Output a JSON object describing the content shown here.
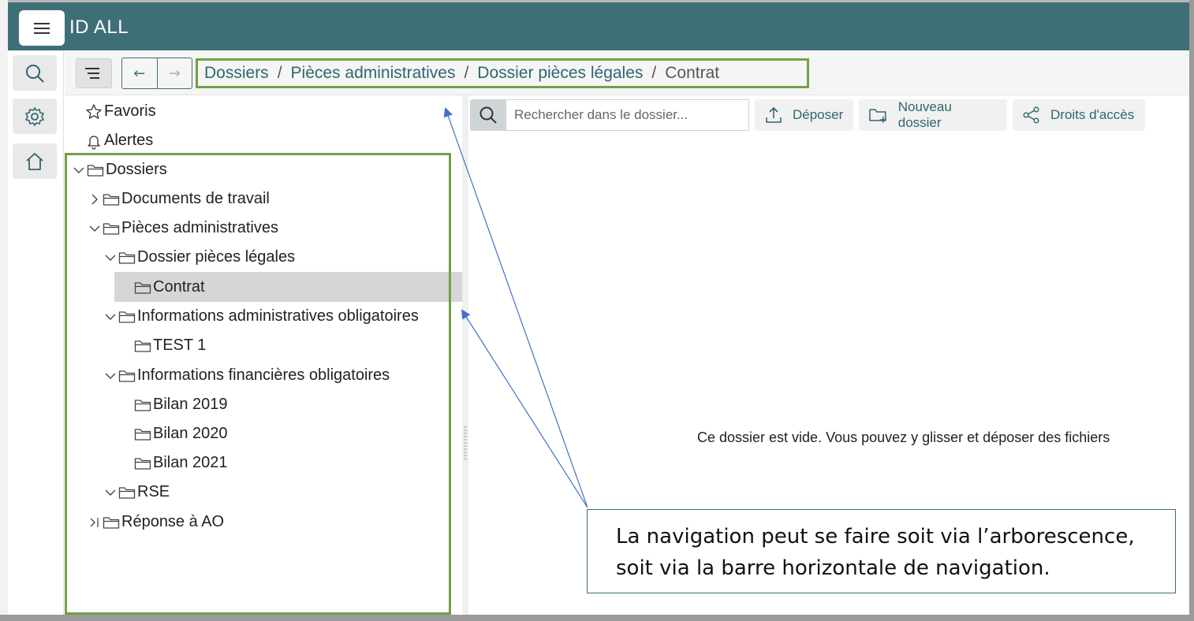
{
  "app": {
    "title": "ID ALL",
    "menu_icon": "hamburger-icon"
  },
  "rail": {
    "items": [
      {
        "icon": "search-icon"
      },
      {
        "icon": "gear-icon"
      },
      {
        "icon": "home-icon"
      }
    ]
  },
  "breadcrumb": {
    "items": [
      "Dossiers",
      "Pièces administratives",
      "Dossier pièces légales",
      "Contrat"
    ],
    "separator": "/",
    "back_label": "←",
    "forward_label": "→"
  },
  "tree": {
    "favorites": "Favoris",
    "alerts": "Alertes",
    "root": "Dossiers",
    "nodes": [
      "Documents de travail",
      "Pièces administratives",
      "Dossier pièces légales",
      "Contrat",
      "Informations administratives obligatoires",
      "TEST 1",
      "Informations financières obligatoires",
      "Bilan 2019",
      "Bilan 2020",
      "Bilan 2021",
      "RSE",
      "Réponse à AO"
    ]
  },
  "toolbar": {
    "search_placeholder": "Rechercher dans le dossier...",
    "upload_label": "Déposer",
    "new_folder_label": "Nouveau dossier",
    "access_label": "Droits d'accès"
  },
  "main": {
    "empty_message": "Ce dossier est vide. Vous pouvez y glisser et déposer des fichiers"
  },
  "callout": {
    "line1": "La navigation peut se faire soit via l’arborescence,",
    "line2": "soit via la barre horizontale de navigation."
  },
  "colors": {
    "brand": "#3f6f76",
    "highlight": "#72a045",
    "link": "#2f6670",
    "arrow": "#4472c4"
  }
}
